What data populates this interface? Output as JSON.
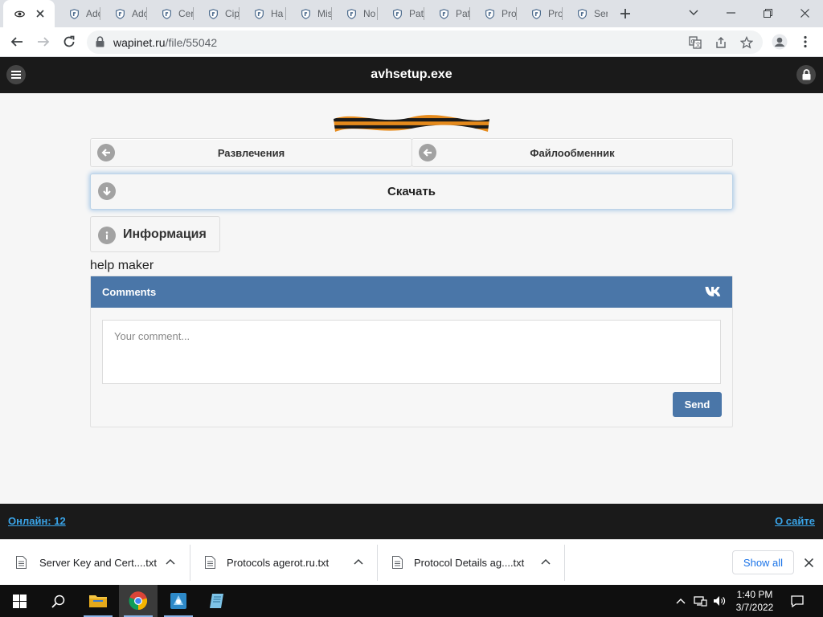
{
  "browser": {
    "tabs": [
      {
        "label": "",
        "icon": "eye-favicon",
        "active": true
      },
      {
        "label": "Adc",
        "icon": "shield-favicon"
      },
      {
        "label": "Adc",
        "icon": "shield-favicon"
      },
      {
        "label": "Cer",
        "icon": "shield-favicon"
      },
      {
        "label": "Cip",
        "icon": "shield-favicon"
      },
      {
        "label": "Ha",
        "icon": "shield-favicon"
      },
      {
        "label": "Mis",
        "icon": "shield-favicon"
      },
      {
        "label": "No",
        "icon": "shield-favicon"
      },
      {
        "label": "Pat",
        "icon": "shield-favicon"
      },
      {
        "label": "Pat",
        "icon": "shield-favicon"
      },
      {
        "label": "Pro",
        "icon": "shield-favicon"
      },
      {
        "label": "Pro",
        "icon": "shield-favicon"
      },
      {
        "label": "Ser",
        "icon": "shield-favicon"
      }
    ],
    "url_host": "wapinet.ru",
    "url_path": "/file/55042"
  },
  "site": {
    "title": "avhsetup.exe",
    "nav": {
      "left_label": "Развлечения",
      "right_label": "Файлообменник"
    },
    "download_label": "Скачать",
    "info_label": "Информация",
    "description": "help maker",
    "comments": {
      "header": "Comments",
      "placeholder": "Your comment...",
      "send_label": "Send"
    },
    "footer": {
      "online_label": "Онлайн: 12",
      "about_label": "О сайте"
    }
  },
  "downloads": {
    "items": [
      {
        "name": "Server Key and Cert....txt"
      },
      {
        "name": "Protocols agerot.ru.txt"
      },
      {
        "name": "Protocol Details ag....txt"
      }
    ],
    "show_all_label": "Show all"
  },
  "taskbar": {
    "time": "1:40 PM",
    "date": "3/7/2022"
  },
  "colors": {
    "vk_blue": "#4a76a8",
    "header_dark": "#1a1a1a",
    "link_blue": "#3aa4e8"
  }
}
